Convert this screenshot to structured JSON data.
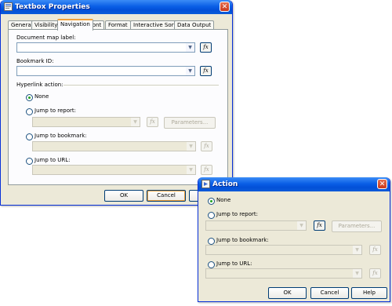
{
  "textbox_dialog": {
    "title": "Textbox Properties",
    "tabs": [
      "General",
      "Visibility",
      "Navigation",
      "Font",
      "Format",
      "Interactive Sort",
      "Data Output"
    ],
    "active_tab": "Navigation",
    "document_map_label": "Document map label:",
    "document_map_value": "",
    "bookmark_id": "Bookmark ID:",
    "bookmark_value": "",
    "hyperlink_action": "Hyperlink action:",
    "options": {
      "none": "None",
      "jump_report": "Jump to report:",
      "jump_bookmark": "Jump to bookmark:",
      "jump_url": "Jump to URL:"
    },
    "fx": "fx",
    "parameters_button": "Parameters...",
    "ok_button": "OK",
    "cancel_button": "Cancel"
  },
  "action_dialog": {
    "title": "Action",
    "options": {
      "none": "None",
      "jump_report": "Jump to report:",
      "jump_bookmark": "Jump to bookmark:",
      "jump_url": "Jump to URL:"
    },
    "fx": "fx",
    "parameters_button": "Parameters...",
    "ok_button": "OK",
    "cancel_button": "Cancel",
    "help_button": "Help"
  }
}
